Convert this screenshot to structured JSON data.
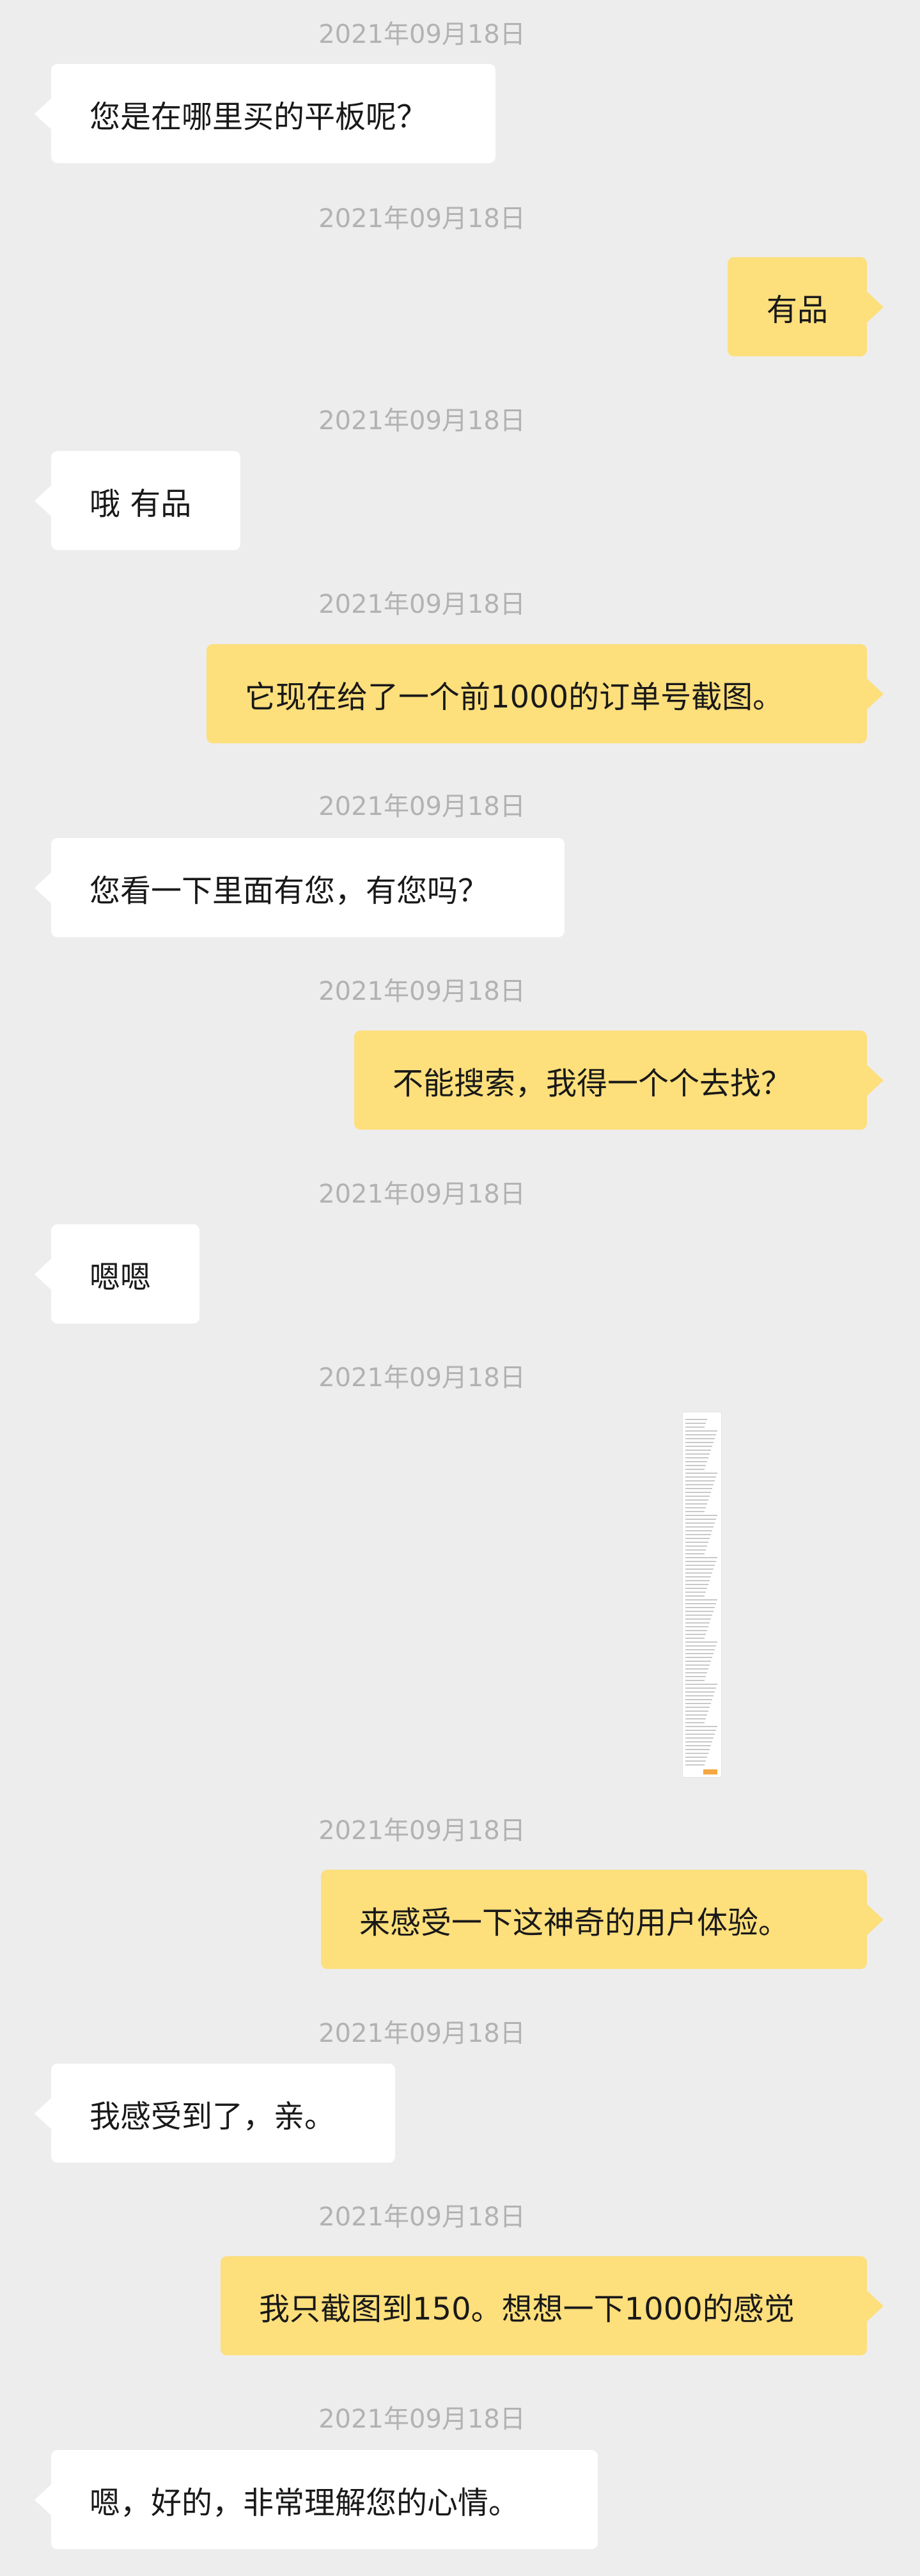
{
  "messages": [
    {
      "timestamp": "2021年09月18日",
      "side": "left",
      "text": "您是在哪里买的平板呢？"
    },
    {
      "timestamp": "2021年09月18日",
      "side": "right",
      "text": "有品"
    },
    {
      "timestamp": "2021年09月18日",
      "side": "left",
      "text": "哦 有品"
    },
    {
      "timestamp": "2021年09月18日",
      "side": "right",
      "text": "它现在给了一个前1000的订单号截图。"
    },
    {
      "timestamp": "2021年09月18日",
      "side": "left",
      "text": "您看一下里面有您，有您吗？"
    },
    {
      "timestamp": "2021年09月18日",
      "side": "right",
      "text": "不能搜索，我得一个个去找？"
    },
    {
      "timestamp": "2021年09月18日",
      "side": "left",
      "text": "嗯嗯"
    },
    {
      "timestamp": "2021年09月18日",
      "side": "right",
      "text": "",
      "attachment": "order-list-screenshot"
    },
    {
      "timestamp": "2021年09月18日",
      "side": "right",
      "text": "来感受一下这神奇的用户体验。"
    },
    {
      "timestamp": "2021年09月18日",
      "side": "left",
      "text": "我感受到了，亲。"
    },
    {
      "timestamp": "2021年09月18日",
      "side": "right",
      "text": "我只截图到150。想想一下1000的感觉"
    },
    {
      "timestamp": "2021年09月18日",
      "side": "left",
      "text": "嗯，好的，非常理解您的心情。"
    }
  ],
  "colors": {
    "background": "#ededed",
    "incoming_bubble": "#ffffff",
    "outgoing_bubble": "#fddf7c",
    "timestamp_text": "#b2b2b2"
  }
}
